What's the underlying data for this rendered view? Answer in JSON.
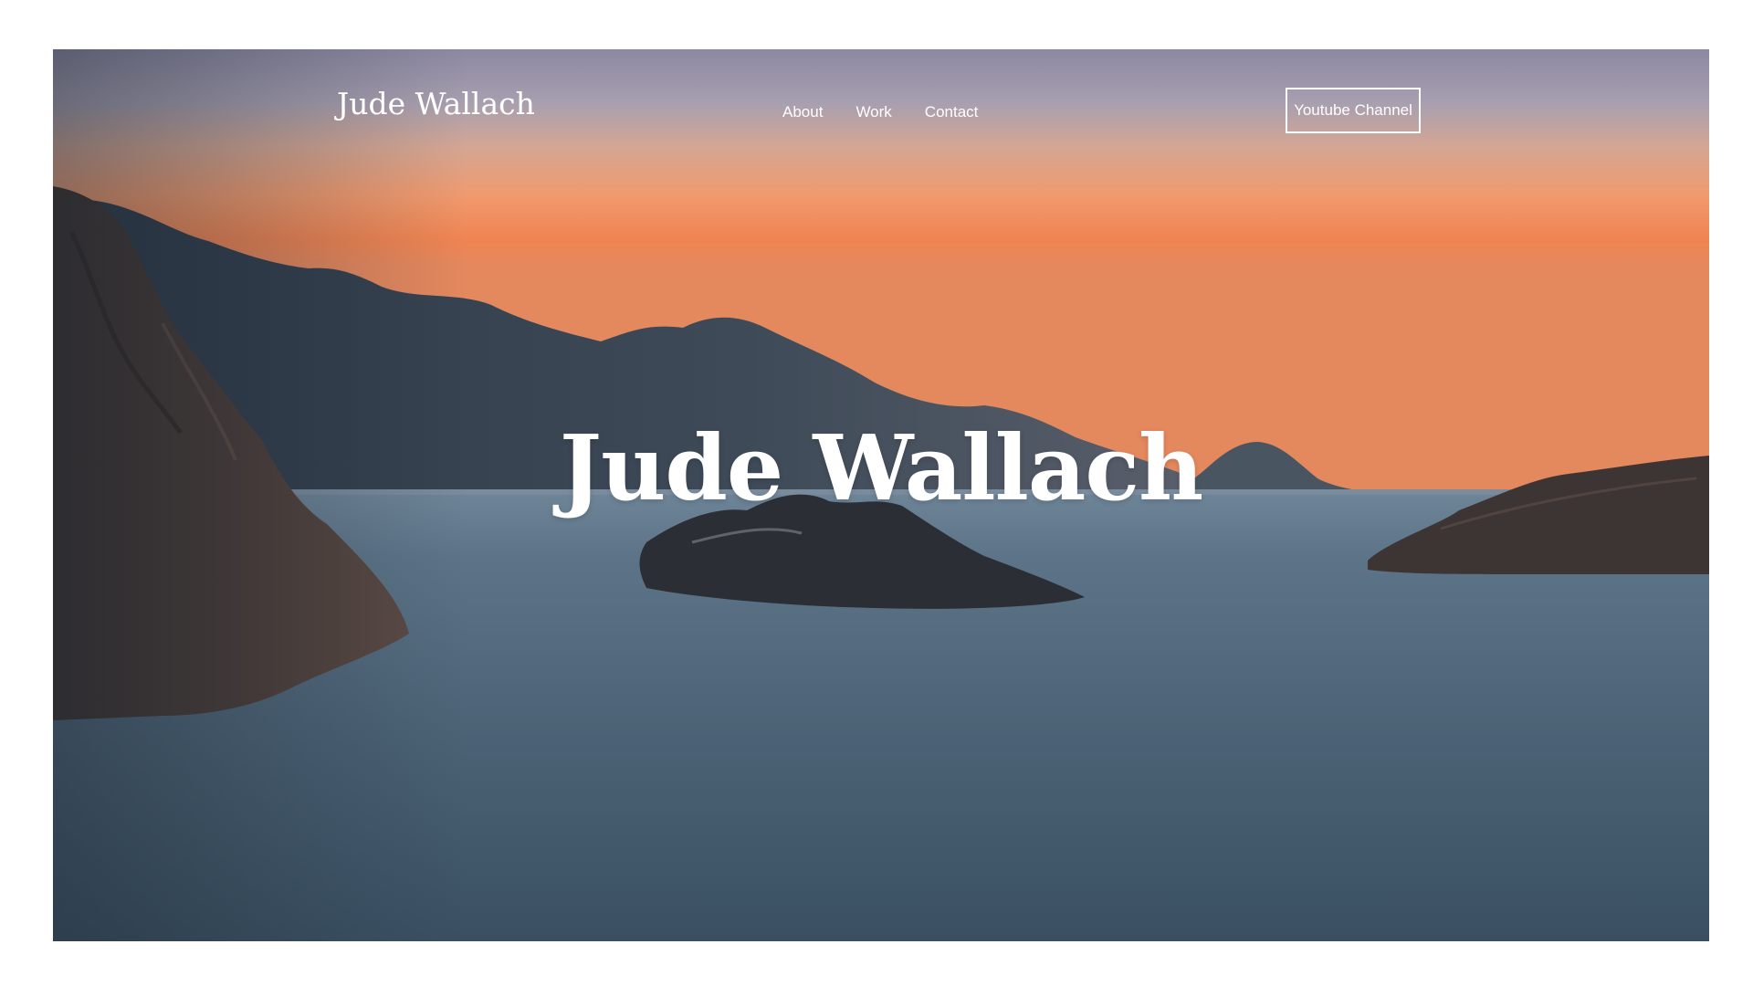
{
  "header": {
    "brand": "Jude Wallach",
    "nav": [
      {
        "label": "About"
      },
      {
        "label": "Work"
      },
      {
        "label": "Contact"
      }
    ],
    "cta_label": "Youtube Channel"
  },
  "hero": {
    "title": "Jude Wallach",
    "background": "sunset-seascape-image"
  },
  "colors": {
    "sky_top": "#8f8aa0",
    "sky_orange": "#f08a55",
    "water": "#4d6478",
    "text": "#ffffff"
  }
}
